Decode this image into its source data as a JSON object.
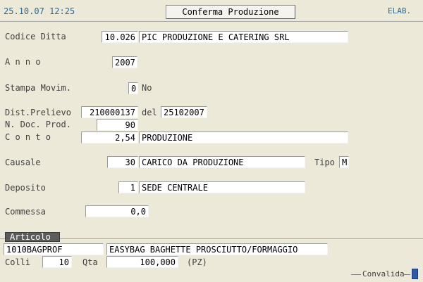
{
  "header": {
    "datetime": "25.10.07 12:25",
    "title_button": "Conferma Produzione",
    "status": "ELAB."
  },
  "form": {
    "codice_ditta": {
      "label": "Codice Ditta",
      "code": "10.026",
      "name": "PIC PRODUZIONE E CATERING SRL"
    },
    "anno": {
      "label": "A n n o",
      "value": "2007"
    },
    "stampa_movim": {
      "label": "Stampa Movim.",
      "value": "0",
      "desc": "No"
    },
    "dist_prelievo": {
      "label": "Dist.Prelievo",
      "value": "210000137",
      "del_label": "del",
      "date": "25102007"
    },
    "n_doc_prod": {
      "label": "N. Doc. Prod.",
      "value": "90"
    },
    "conto": {
      "label": "C o n t o",
      "code": "2,54",
      "desc": "PRODUZIONE"
    },
    "causale": {
      "label": "Causale",
      "code": "30",
      "desc": "CARICO DA PRODUZIONE",
      "tipo_label": "Tipo",
      "tipo": "M"
    },
    "deposito": {
      "label": "Deposito",
      "code": "1",
      "desc": "SEDE CENTRALE"
    },
    "commessa": {
      "label": "Commessa",
      "value": "0,0"
    }
  },
  "articolo": {
    "tab_label": "Articolo",
    "code": "1010BAGPROF",
    "desc": "EASYBAG BAGHETTE PROSCIUTTO/FORMAGGIO",
    "colli_label": "Colli",
    "colli": "10",
    "qta_label": "Qta",
    "qta": "100,000",
    "unit": "(PZ)"
  },
  "footer": {
    "convalida": "Convalida"
  },
  "colors": {
    "background": "#ece9d8",
    "field": "#ffffff",
    "accent_text": "#2a6a9a",
    "tab": "#5c5c5c",
    "convalida_square": "#2c5aa8"
  }
}
